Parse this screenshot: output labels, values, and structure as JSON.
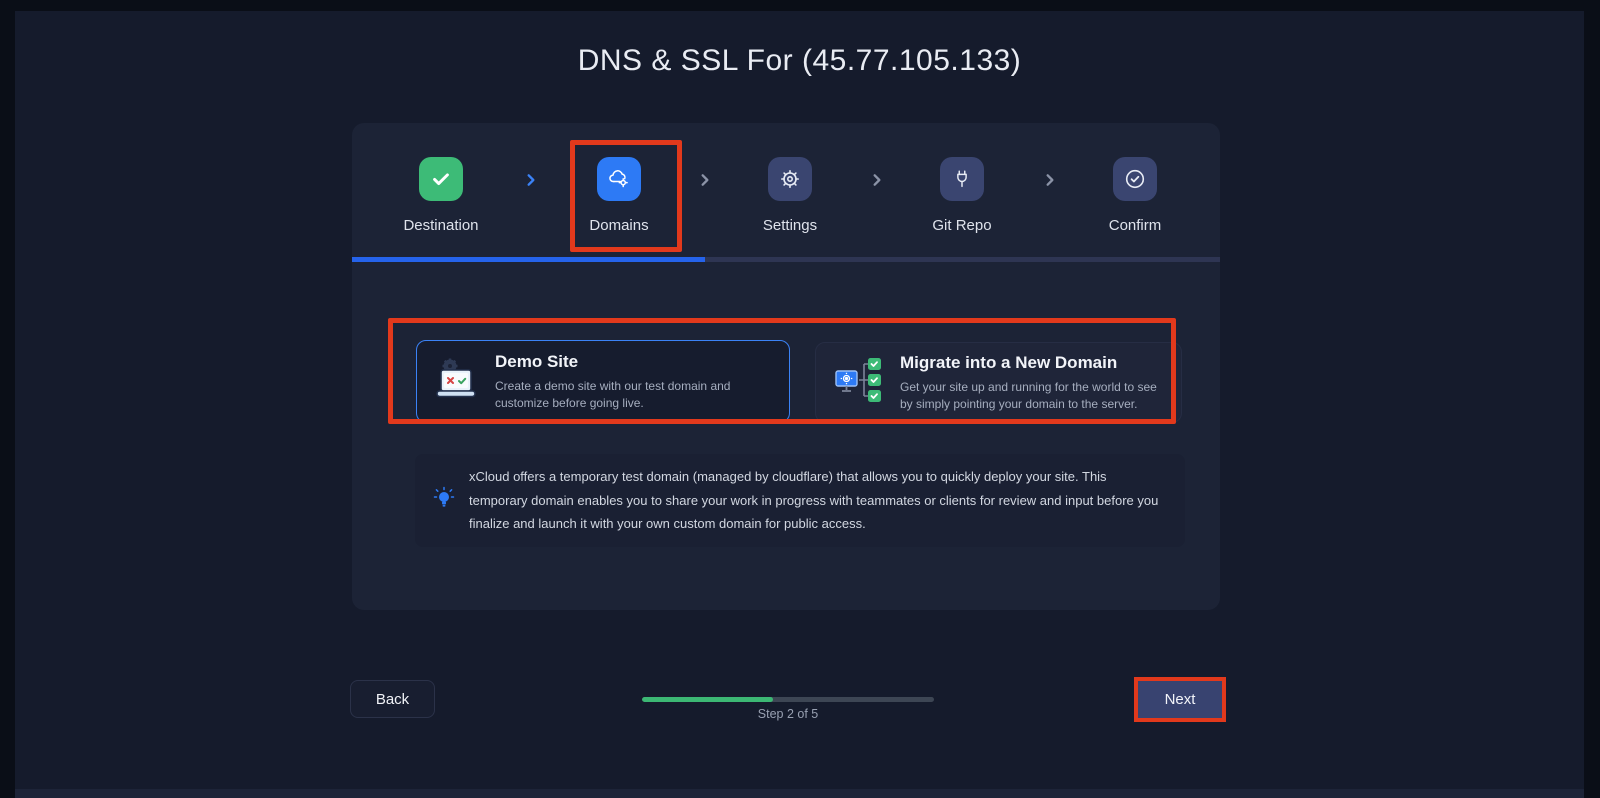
{
  "window": {
    "title": "DNS & SSL For (45.77.105.133)"
  },
  "stepper": {
    "steps": [
      {
        "label": "Destination",
        "state": "completed"
      },
      {
        "label": "Domains",
        "state": "active"
      },
      {
        "label": "Settings",
        "state": "upcoming"
      },
      {
        "label": "Git Repo",
        "state": "upcoming"
      },
      {
        "label": "Confirm",
        "state": "upcoming"
      }
    ],
    "progress_percent": 40.7
  },
  "domain_options": {
    "demo_site": {
      "title": "Demo Site",
      "description": "Create a demo site with our test domain and customize before going live.",
      "selected": true
    },
    "migrate": {
      "title": "Migrate into a New Domain",
      "description": "Get your site up and running for the world to see by simply pointing your domain to the server.",
      "selected": false
    }
  },
  "info_note": {
    "text": "xCloud offers a temporary test domain (managed by cloudflare) that allows you to quickly deploy your site. This temporary domain enables you to share your work in progress with teammates or clients for review and input before you finalize and launch it with your own custom domain for public access."
  },
  "footer": {
    "back_label": "Back",
    "next_label": "Next",
    "step_indicator": "Step 2 of 5",
    "progress_percent": 45
  },
  "colors": {
    "accent_blue": "#2d7af5",
    "success_green": "#3dbb77",
    "annotation_red": "#e2391c",
    "selected_card_border": "#3b82f6",
    "underline_blue": "#2563eb",
    "progress_track": "#3d4654",
    "panel_bg": "#1c2336",
    "page_bg": "#151b2c"
  }
}
